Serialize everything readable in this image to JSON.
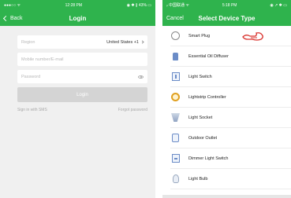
{
  "login_screen": {
    "status": {
      "carrier": "●●●○○ ᯤ",
      "time": "12:28 PM",
      "indicators": "◉ ✱ ∦ 43% ▭"
    },
    "nav": {
      "back_label": "Back",
      "title": "Login"
    },
    "form": {
      "region_label": "Region",
      "region_value": "United States +1",
      "phone_placeholder": "Mobile number/E-mail",
      "password_placeholder": "Password",
      "login_button": "Login",
      "sms_link": "Sign in with SMS",
      "forgot_link": "Forgot password"
    }
  },
  "device_screen": {
    "status": {
      "carrier": "ᵢₗ 中国联通 ᯤ",
      "time": "5:18 PM",
      "indicators": "◉ ↗ ✱ ▭"
    },
    "nav": {
      "cancel_label": "Cancel",
      "title": "Select Device Type"
    },
    "devices": [
      {
        "name": "Smart Plug",
        "icon": "plug-icon"
      },
      {
        "name": "Essential Oil Diffuser",
        "icon": "diffuser-icon"
      },
      {
        "name": "Light Switch",
        "icon": "light-switch-icon"
      },
      {
        "name": "Lightstrip Controller",
        "icon": "lightstrip-icon"
      },
      {
        "name": "Light Socket",
        "icon": "light-socket-icon"
      },
      {
        "name": "Outdoor Outlet",
        "icon": "outdoor-outlet-icon"
      },
      {
        "name": "Dimmer Light Switch",
        "icon": "dimmer-switch-icon"
      },
      {
        "name": "Light Bulb",
        "icon": "light-bulb-icon"
      }
    ]
  },
  "colors": {
    "brand_green": "#2fb34d",
    "pointer_red": "#d9332e",
    "icon_blue": "#6b8cc7"
  }
}
